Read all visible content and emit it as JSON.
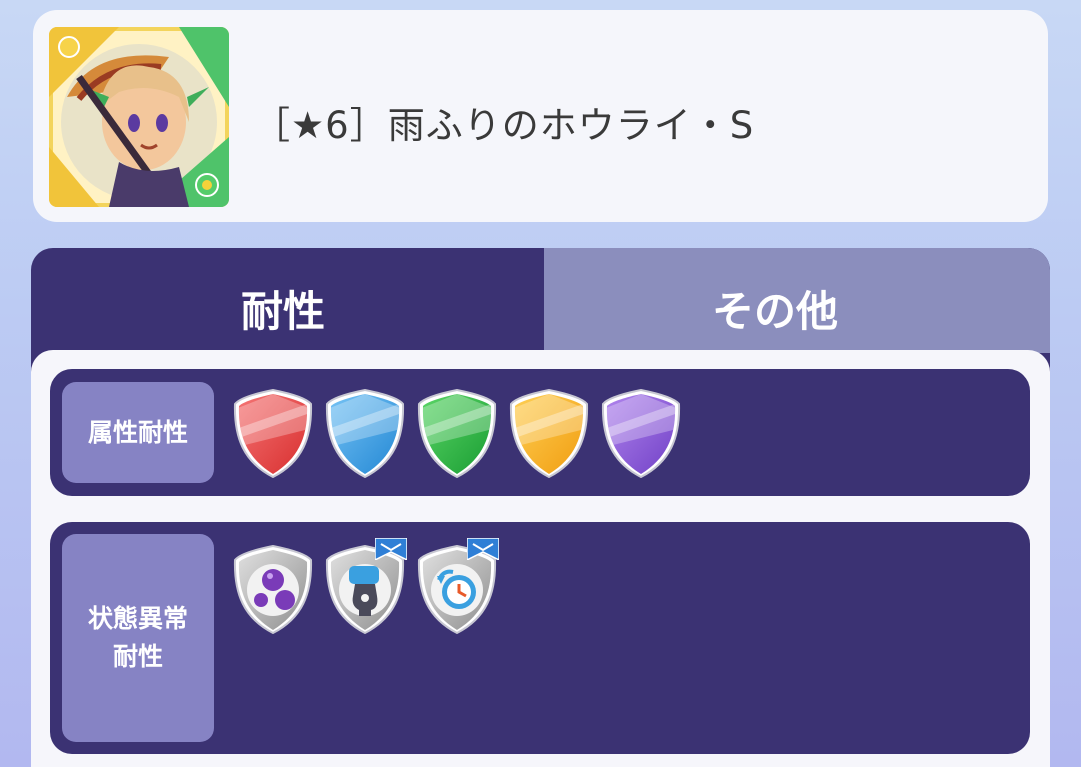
{
  "header": {
    "character_name": "［★6］雨ふりのホウライ・S",
    "portrait_icon": "character-portrait"
  },
  "tabs": [
    {
      "label": "耐性",
      "active": true
    },
    {
      "label": "その他",
      "active": false
    }
  ],
  "rows": [
    {
      "label": "属性耐性",
      "icons": [
        {
          "name": "red-shield-icon",
          "color": "#e84a4a"
        },
        {
          "name": "blue-shield-icon",
          "color": "#3ea4e8"
        },
        {
          "name": "green-shield-icon",
          "color": "#2db84a"
        },
        {
          "name": "yellow-shield-icon",
          "color": "#f5b21e"
        },
        {
          "name": "purple-shield-icon",
          "color": "#8b5ad8"
        }
      ]
    },
    {
      "label": "状態異常\n耐性",
      "icons": [
        {
          "name": "poison-bubbles-shield-icon",
          "badge": false
        },
        {
          "name": "fist-lock-shield-icon",
          "badge": true
        },
        {
          "name": "clock-stop-shield-icon",
          "badge": true
        }
      ]
    }
  ],
  "colors": {
    "panel": "#3b3273",
    "label_bg": "#8683c4",
    "inactive_tab": "#8b8ebd"
  }
}
